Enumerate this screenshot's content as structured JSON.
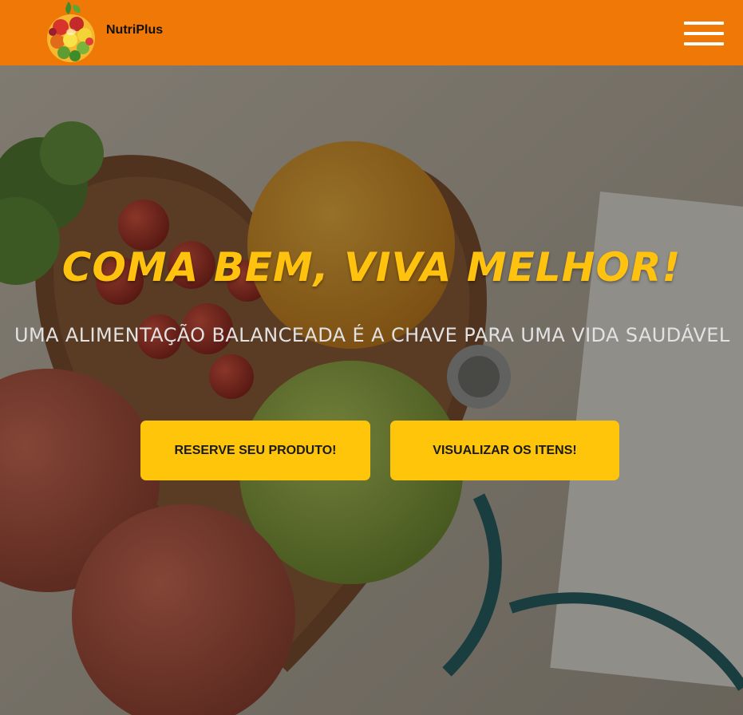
{
  "header": {
    "brand": "NutriPlus",
    "logo_icon": "fruit-bowl-logo",
    "menu_icon": "hamburger-menu-icon",
    "background_color": "#f07807"
  },
  "hero": {
    "title": "Coma bem, viva melhor!",
    "subtitle": "Uma alimentação balanceada é a chave para uma vida saudável",
    "title_color": "#ffc20e",
    "buttons": {
      "reserve": "RESERVE SEU PRODUTO!",
      "view": "VISUALIZAR OS ITENS!"
    },
    "button_color": "#ffc50b"
  }
}
